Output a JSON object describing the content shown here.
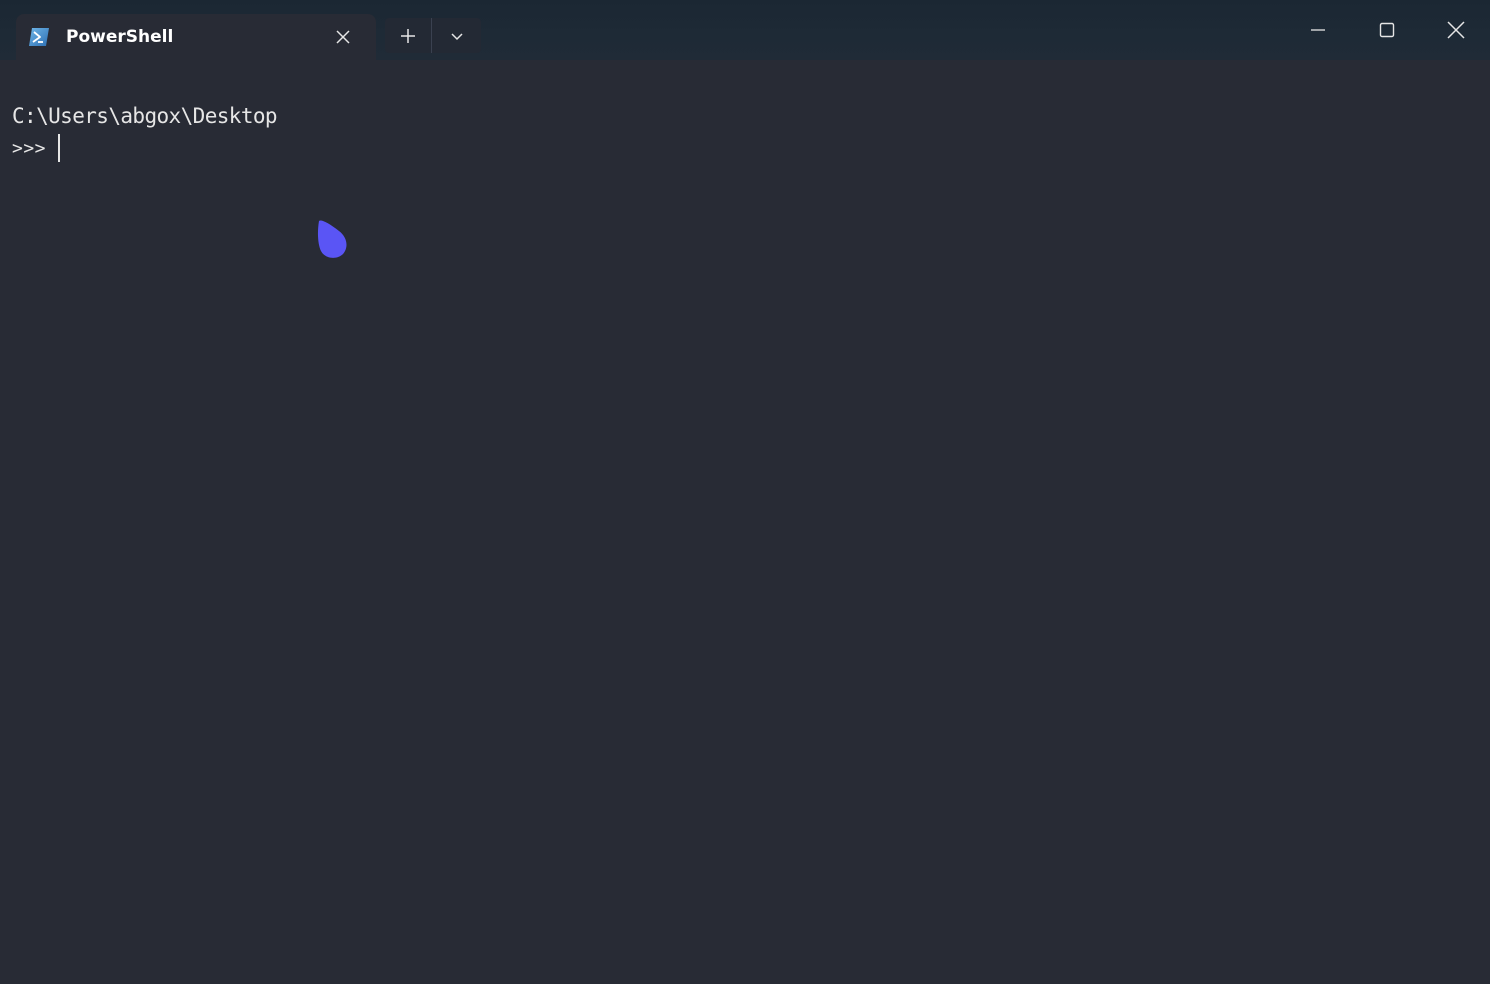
{
  "window": {
    "tab": {
      "title": "PowerShell",
      "icon": "powershell-icon"
    },
    "buttons": {
      "new_tab_icon": "plus-icon",
      "dropdown_icon": "chevron-down-icon",
      "minimize_icon": "minimize-icon",
      "maximize_icon": "maximize-icon",
      "close_icon": "close-icon"
    }
  },
  "terminal": {
    "path": "C:\\Users\\abgox\\Desktop",
    "prompt": ">>>"
  },
  "colors": {
    "background": "#282b35",
    "titlebar": "#1e2a36",
    "text": "#e6e6e6",
    "accent_drop": "#5a55f5"
  }
}
